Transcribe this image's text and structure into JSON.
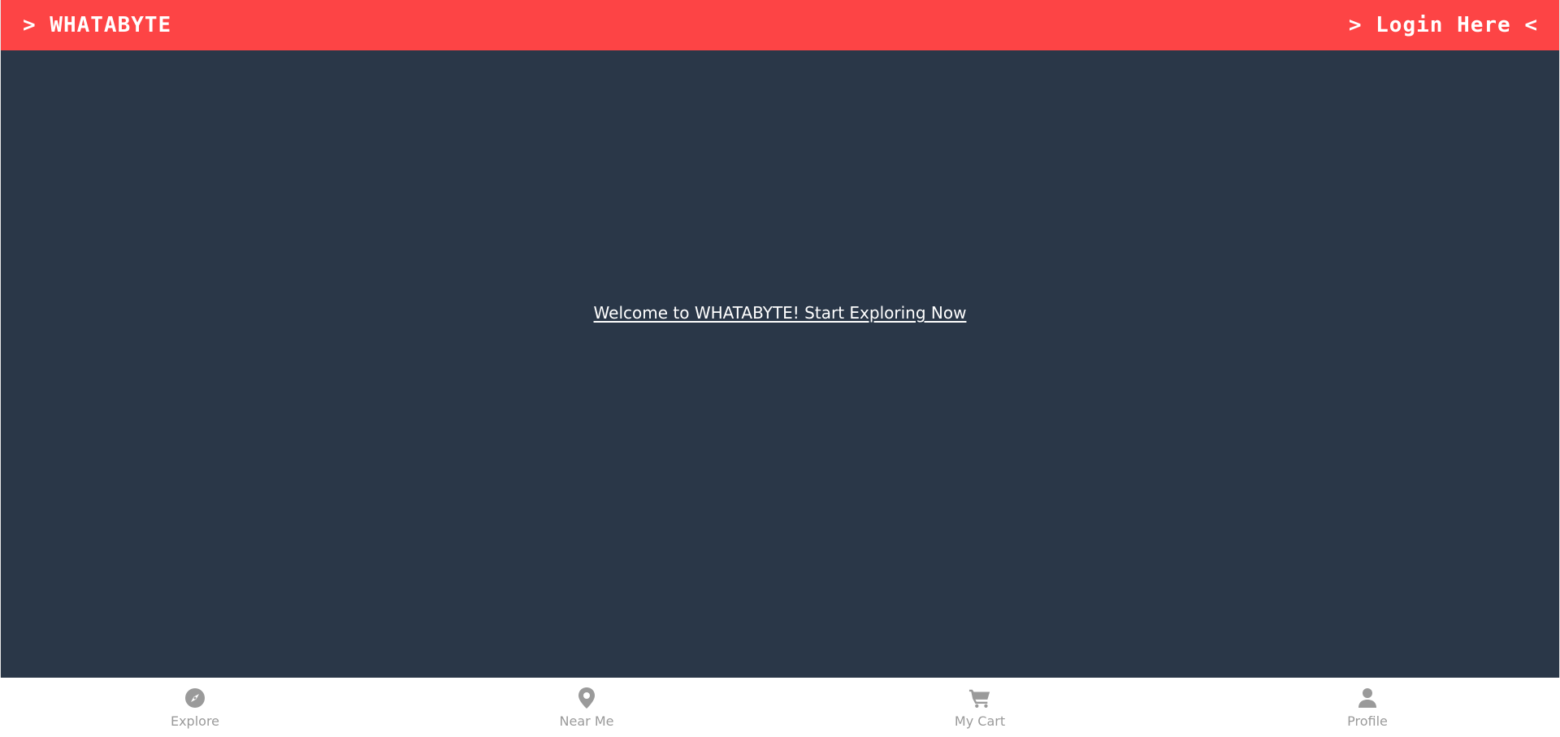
{
  "header": {
    "brand": "> WHATABYTE",
    "login": "> Login Here <"
  },
  "main": {
    "welcome": "Welcome to WHATABYTE! Start Exploring Now"
  },
  "bottom_nav": {
    "items": [
      {
        "label": "Explore",
        "icon": "compass-icon"
      },
      {
        "label": "Near Me",
        "icon": "map-pin-icon"
      },
      {
        "label": "My Cart",
        "icon": "shopping-cart-icon"
      },
      {
        "label": "Profile",
        "icon": "user-icon"
      }
    ]
  },
  "colors": {
    "header_bg": "#fd4445",
    "main_bg": "#2a3748",
    "nav_bg": "#ffffff",
    "nav_icon": "#9a9a9a",
    "text_light": "#ffffff"
  }
}
